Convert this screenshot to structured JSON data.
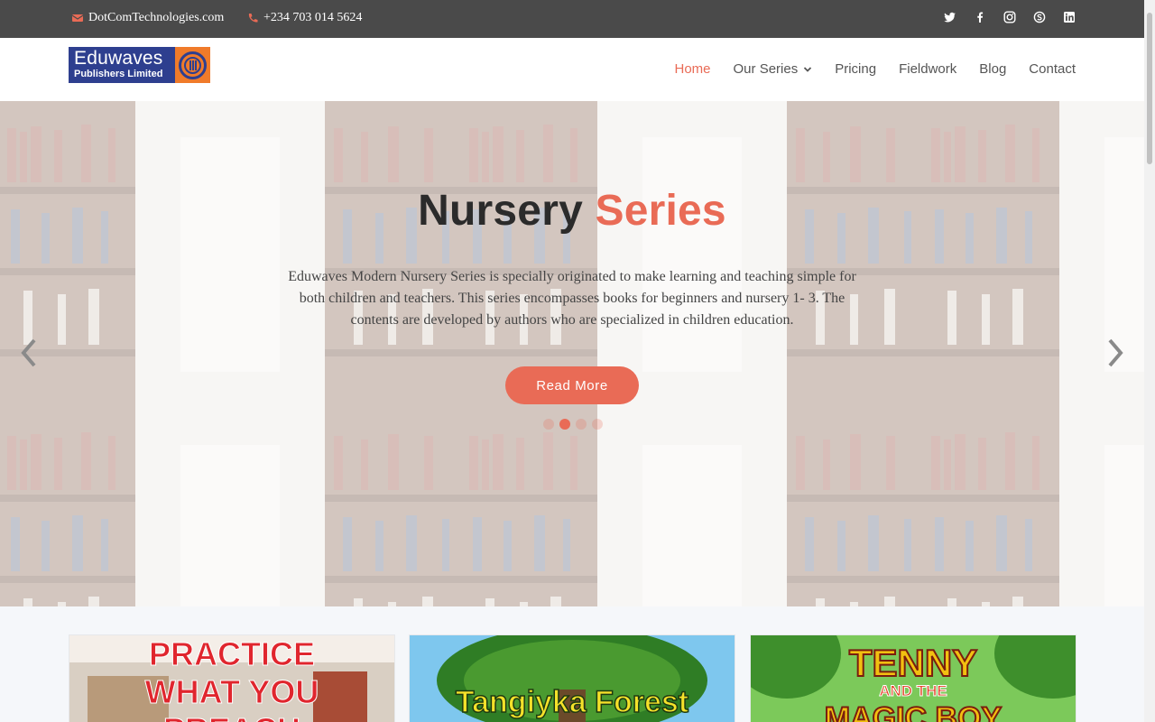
{
  "topbar": {
    "email": "DotComTechnologies.com",
    "phone": "+234 703 014 5624",
    "social": [
      "twitter-icon",
      "facebook-icon",
      "instagram-icon",
      "skype-icon",
      "linkedin-icon"
    ]
  },
  "logo": {
    "line1": "Eduwaves",
    "line2": "Publishers Limited"
  },
  "nav": {
    "items": [
      {
        "label": "Home",
        "active": true
      },
      {
        "label": "Our Series",
        "dropdown": true
      },
      {
        "label": "Pricing"
      },
      {
        "label": "Fieldwork"
      },
      {
        "label": "Blog"
      },
      {
        "label": "Contact"
      }
    ]
  },
  "hero": {
    "title_main": "Nursery ",
    "title_accent": "Series",
    "description": "Eduwaves Modern Nursery Series is specially originated to make learning and teaching simple for both children and teachers. This series encompasses books for beginners and nursery 1- 3. The contents are developed by authors who are specialized in children education.",
    "button": "Read More",
    "slides": 4,
    "active_slide": 2
  },
  "cards": [
    {
      "line1": "PRACTICE",
      "line2": "WHAT YOU",
      "line3": "PREACH"
    },
    {
      "line1": "Tangiyka Forest"
    },
    {
      "line1": "TENNY",
      "line2": "AND THE",
      "line3": "MAGIC BOY"
    }
  ],
  "colors": {
    "accent": "#e96b56",
    "topbar": "#4a4a4a",
    "logo_blue": "#2e3f8f",
    "logo_orange": "#f07b2a"
  }
}
